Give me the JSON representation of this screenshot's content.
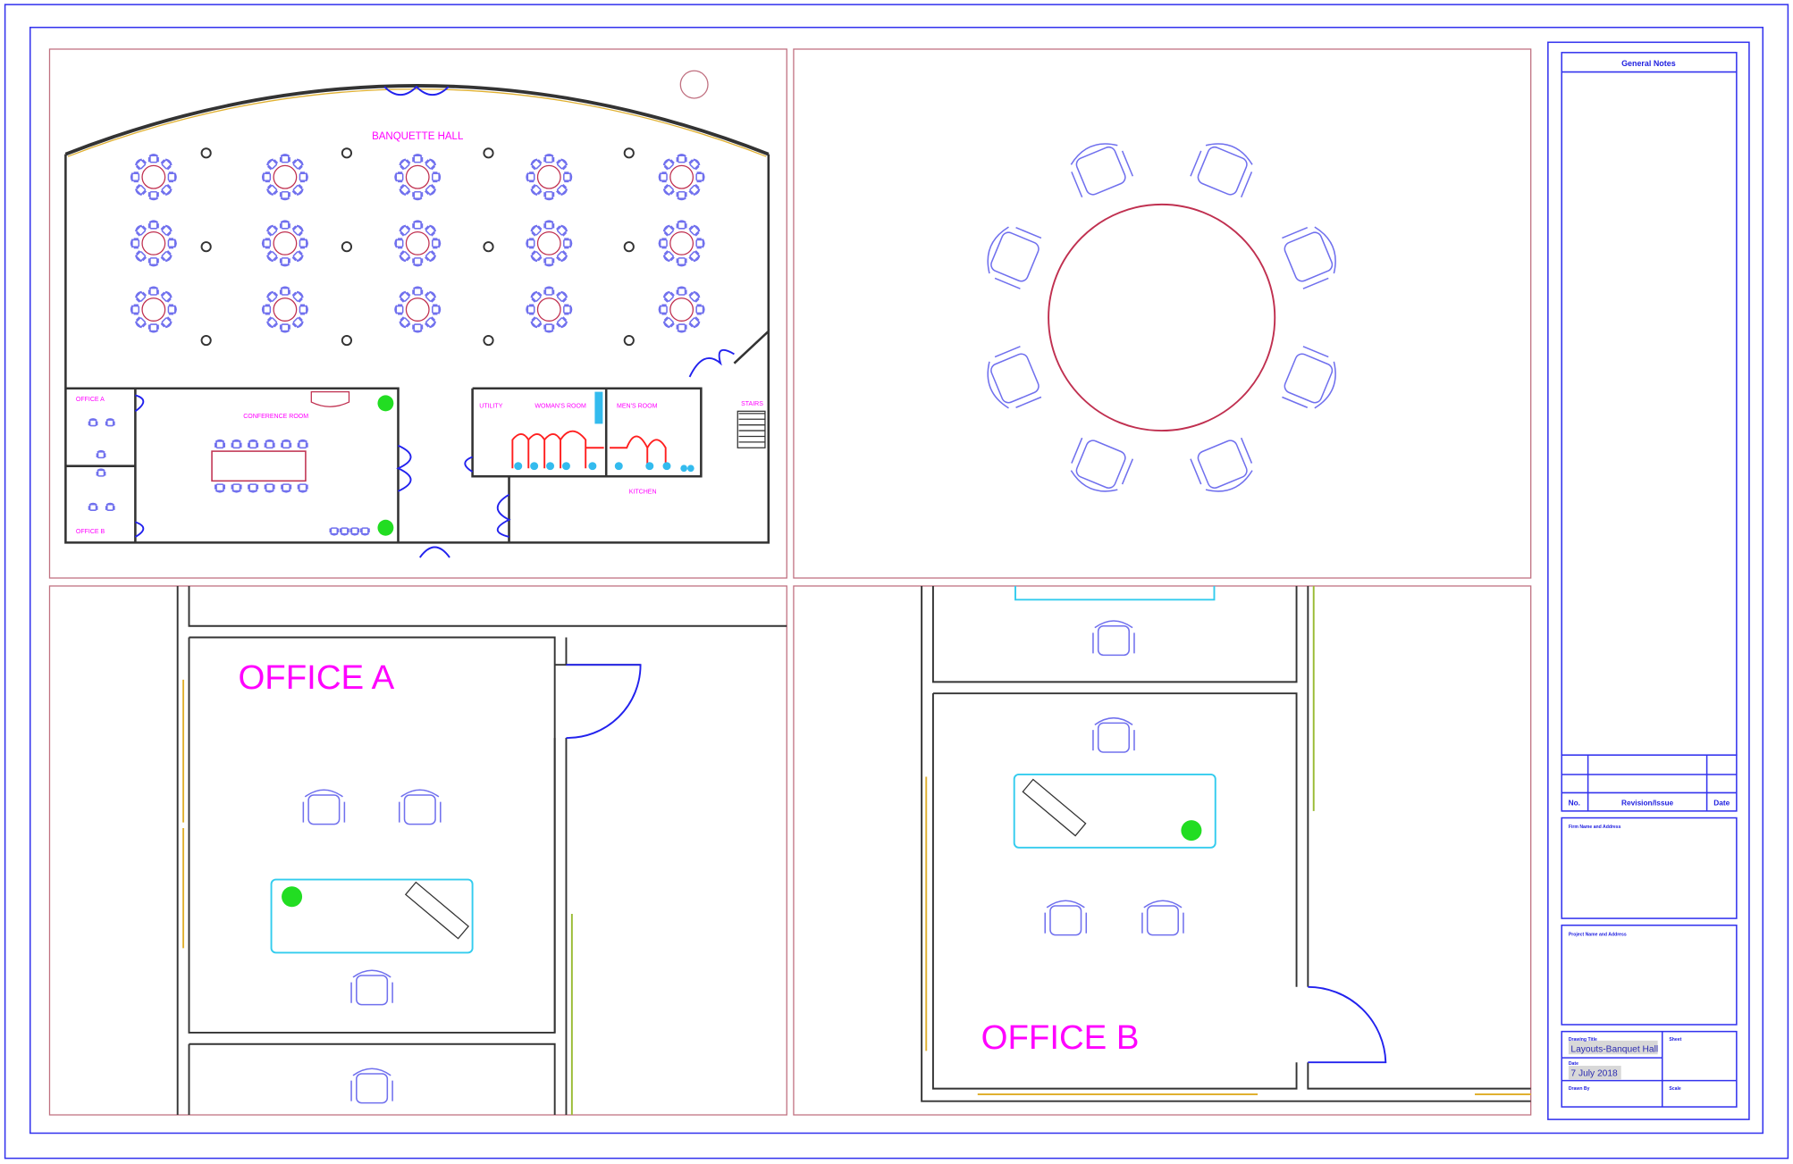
{
  "sheet": {
    "colors": {
      "frame": "#3333ee",
      "viewport": "#c07080",
      "wall": "#333333",
      "label": "#ff00ff",
      "chair": "#7070ee",
      "table": "#c03050",
      "desk": "#33ccee",
      "plant": "#22dd22",
      "window": "#e0b030"
    },
    "banquet_plan": {
      "hall_label": "BANQUETTE HALL",
      "office_a": "OFFICE A",
      "office_b": "OFFICE B",
      "conference": "CONFERENCE ROOM",
      "utility": "UTILITY",
      "womens": "WOMAN'S ROOM",
      "mens": "MEN'S ROOM",
      "stairs": "STAIRS",
      "kitchen": "KITCHEN"
    },
    "detail_office_a": {
      "label": "OFFICE A"
    },
    "detail_office_b": {
      "label": "OFFICE B"
    },
    "title_block": {
      "general_notes": "General Notes",
      "rev_no": "No.",
      "rev_issue": "Revision/Issue",
      "rev_date": "Date",
      "firm": "Firm Name and Address",
      "project": "Project Name and Address",
      "drawing_title_label": "Drawing Title",
      "drawing_title": "Layouts-Banquet Hall",
      "date_label": "Date",
      "date": "7 July 2018",
      "sheet_label": "Sheet",
      "drawn_by_label": "Drawn By",
      "scale_label": "Scale"
    }
  }
}
